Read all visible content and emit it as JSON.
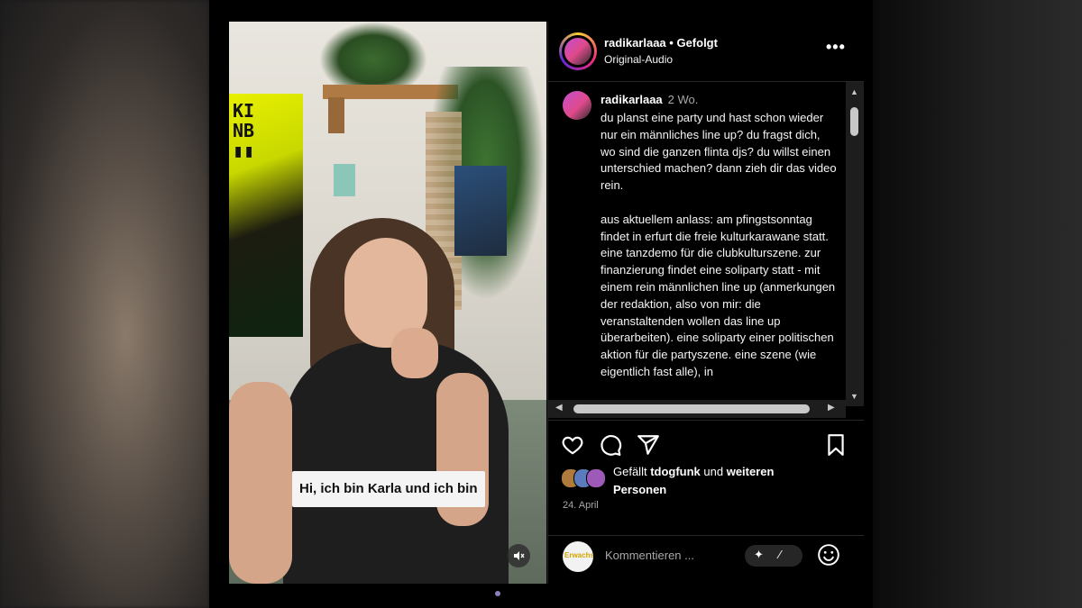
{
  "post": {
    "username": "radikarlaaa",
    "separator": " • ",
    "follow_status": "Gefolgt",
    "audio": "Original-Audio",
    "more": "•••"
  },
  "video": {
    "caption": "Hi, ich bin Karla und ich bin",
    "mute_icon": "muted-speaker-icon"
  },
  "comment": {
    "username": "radikarlaaa",
    "time": "2 Wo.",
    "text": "du planst eine party und hast schon wieder nur ein männliches line up? du fragst dich, wo sind die ganzen flinta djs? du willst einen unterschied machen? dann zieh dir das video rein.\n\naus aktuellem anlass: am pfingstsonntag findet in erfurt die freie kulturkarawane statt. eine tanzdemo für die clubkulturszene. zur finanzierung findet eine soliparty statt - mit einem rein männlichen line up (anmerkungen der redaktion, also von mir: die veranstaltenden wollen das line up überarbeiten). eine soliparty einer politischen aktion für die partyszene. eine szene (wie eigentlich fast alle), in"
  },
  "likes": {
    "prefix": "Gefällt ",
    "user": "tdogfunk",
    "middle": " und ",
    "suffix": "weiteren Personen"
  },
  "date": "24. April",
  "composer": {
    "placeholder": "Kommentieren ...",
    "avatar_text": "Erwachs"
  },
  "icons": {
    "like": "heart-icon",
    "comment": "comment-bubble-icon",
    "share": "paper-plane-icon",
    "save": "bookmark-icon",
    "emoji": "smiley-icon"
  },
  "colors": {
    "panel_bg": "#000000",
    "text": "#ffffff",
    "muted": "#a8a8a8"
  }
}
